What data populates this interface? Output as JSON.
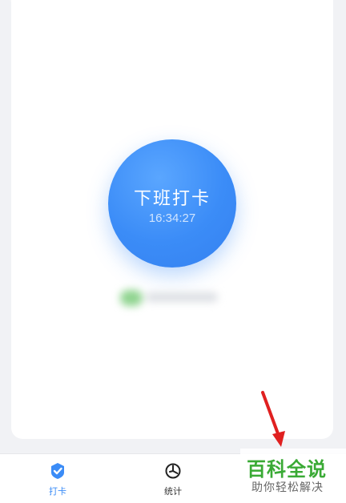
{
  "clock_in": {
    "label": "下班打卡",
    "time": "16:34:27"
  },
  "tabbar": {
    "tabs": [
      {
        "label": "打卡",
        "icon": "check-circle-icon",
        "active": true
      },
      {
        "label": "统计",
        "icon": "pie-chart-icon",
        "active": false
      },
      {
        "label": "",
        "icon": "",
        "active": false
      }
    ]
  },
  "watermark": {
    "title": "百科全说",
    "subtitle": "助你轻松解决"
  },
  "colors": {
    "accent": "#3b8cf7",
    "watermark_green": "#3aaa35",
    "arrow_red": "#e02020"
  }
}
